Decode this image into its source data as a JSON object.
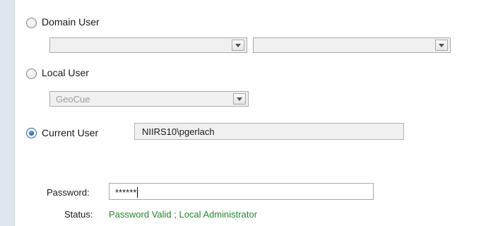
{
  "login_options": {
    "domain_user": {
      "label": "Domain User",
      "selected": false,
      "domain_value": "",
      "user_value": ""
    },
    "local_user": {
      "label": "Local User",
      "selected": false,
      "user_value": "GeoCue"
    },
    "current_user": {
      "label": "Current User",
      "selected": true,
      "value": "NIIRS10\\pgerlach"
    }
  },
  "password": {
    "label": "Password:",
    "value": "******"
  },
  "status": {
    "label": "Status:",
    "value": "Password Valid ; Local Administrator",
    "color": "#1f8a2a"
  },
  "icons": {
    "combo_arrow": "chevron-down-icon"
  }
}
